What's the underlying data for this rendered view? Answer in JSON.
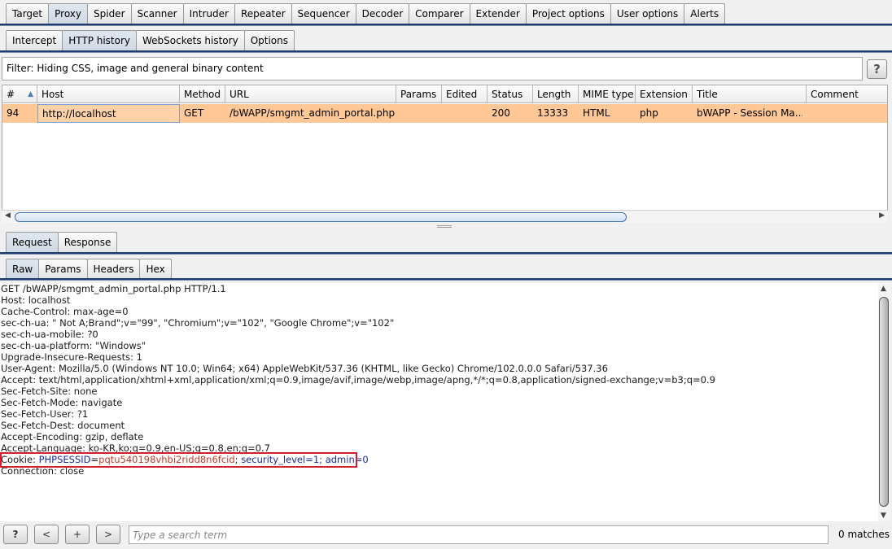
{
  "main_tabs": [
    "Target",
    "Proxy",
    "Spider",
    "Scanner",
    "Intruder",
    "Repeater",
    "Sequencer",
    "Decoder",
    "Comparer",
    "Extender",
    "Project options",
    "User options",
    "Alerts"
  ],
  "proxy_tabs": [
    "Intercept",
    "HTTP history",
    "WebSockets history",
    "Options"
  ],
  "filter_text": "Filter: Hiding CSS, image and general binary content",
  "help_label": "?",
  "table": {
    "columns": [
      "#",
      "Host",
      "Method",
      "URL",
      "Params",
      "Edited",
      "Status",
      "Length",
      "MIME type",
      "Extension",
      "Title",
      "Comment"
    ],
    "sort_indicator": "▲",
    "rows": [
      [
        "94",
        "http://localhost",
        "GET",
        "/bWAPP/smgmt_admin_portal.php",
        "",
        "",
        "200",
        "13333",
        "HTML",
        "php",
        "bWAPP - Session Ma...",
        ""
      ]
    ]
  },
  "message_tabs": [
    "Request",
    "Response"
  ],
  "view_tabs": [
    "Raw",
    "Params",
    "Headers",
    "Hex"
  ],
  "request_lines": [
    "GET /bWAPP/smgmt_admin_portal.php HTTP/1.1",
    "Host: localhost",
    "Cache-Control: max-age=0",
    "sec-ch-ua: \" Not A;Brand\";v=\"99\", \"Chromium\";v=\"102\", \"Google Chrome\";v=\"102\"",
    "sec-ch-ua-mobile: ?0",
    "sec-ch-ua-platform: \"Windows\"",
    "Upgrade-Insecure-Requests: 1",
    "User-Agent: Mozilla/5.0 (Windows NT 10.0; Win64; x64) AppleWebKit/537.36 (KHTML, like Gecko) Chrome/102.0.0.0 Safari/537.36",
    "Accept: text/html,application/xhtml+xml,application/xml;q=0.9,image/avif,image/webp,image/apng,*/*;q=0.8,application/signed-exchange;v=b3;q=0.9",
    "Sec-Fetch-Site: none",
    "Sec-Fetch-Mode: navigate",
    "Sec-Fetch-User: ?1",
    "Sec-Fetch-Dest: document",
    "Accept-Encoding: gzip, deflate",
    "Accept-Language: ko-KR,ko;q=0.9,en-US;q=0.8,en;q=0.7"
  ],
  "cookie": {
    "prefix": "Cookie: ",
    "c1_name": "PHPSESSID",
    "c1_eq": "=",
    "c1_value": "pqtu540198vhbi2ridd8n6fcid",
    "sep1": "; ",
    "c2_name": "security_level",
    "c2_eq": "=",
    "c2_value": "1",
    "sep2": "; ",
    "c3_name": "admin",
    "c3_eq": "=",
    "c3_value": "0"
  },
  "last_line": "Connection: close",
  "bottom": {
    "help": "?",
    "prev": "<",
    "add": "+",
    "next": ">",
    "search_placeholder": "Type a search term",
    "matches": "0 matches"
  },
  "colors": {
    "selected_row": "#ffc896",
    "tab_line": "#1e3b70",
    "cookie_highlight": "#d21f2c",
    "param_name": "#1c2b9c",
    "param_value": "#c0392b"
  }
}
